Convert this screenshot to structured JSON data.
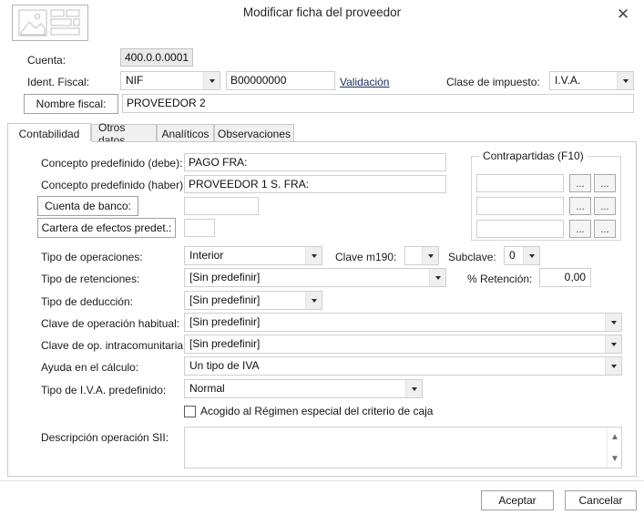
{
  "window": {
    "title": "Modificar ficha del proveedor",
    "close_label": "✕",
    "app_icon": "document-thumbnail-icon"
  },
  "header": {
    "cuenta_label": "Cuenta:",
    "cuenta_value": "400.0.0.0001",
    "ident_fiscal_label": "Ident. Fiscal:",
    "ident_fiscal_type": "NIF",
    "ident_fiscal_number": "B00000000",
    "validacion_link": "Validación",
    "clase_impuesto_label": "Clase de impuesto:",
    "clase_impuesto_value": "I.V.A.",
    "nombre_fiscal_button": "Nombre fiscal:",
    "nombre_fiscal_value": "PROVEEDOR 2"
  },
  "tabs": [
    {
      "label": "Contabilidad",
      "active": true
    },
    {
      "label": "Otros datos",
      "active": false
    },
    {
      "label": "Analíticos",
      "active": false
    },
    {
      "label": "Observaciones",
      "active": false
    }
  ],
  "contabilidad": {
    "concepto_debe_label": "Concepto predefinido (debe):",
    "concepto_debe_value": "PAGO FRA:",
    "concepto_haber_label": "Concepto predefinido (haber):",
    "concepto_haber_value": "PROVEEDOR 1 S. FRA:",
    "cuenta_banco_button": "Cuenta de banco:",
    "cuenta_banco_value": "",
    "cartera_efectos_button": "Cartera de efectos predet.:",
    "cartera_efectos_value": "",
    "tipo_operaciones_label": "Tipo de operaciones:",
    "tipo_operaciones_value": "Interior",
    "clave_m190_label": "Clave m190:",
    "clave_m190_value": "",
    "subclave_label": "Subclave:",
    "subclave_value": "0",
    "tipo_retenciones_label": "Tipo de retenciones:",
    "tipo_retenciones_value": "[Sin predefinir]",
    "pct_retencion_label": "% Retención:",
    "pct_retencion_value": "0,00",
    "tipo_deduccion_label": "Tipo de deducción:",
    "tipo_deduccion_value": "[Sin predefinir]",
    "clave_op_habitual_label": "Clave de operación habitual:",
    "clave_op_habitual_value": "[Sin predefinir]",
    "clave_op_intra_label": "Clave de op. intracomunitaria:",
    "clave_op_intra_value": "[Sin predefinir]",
    "ayuda_calculo_label": "Ayuda en el cálculo:",
    "ayuda_calculo_value": "Un tipo de IVA",
    "tipo_iva_label": "Tipo de I.V.A. predefinido:",
    "tipo_iva_value": "Normal",
    "regimen_caja_label": "Acogido al Régimen especial del criterio de caja",
    "regimen_caja_checked": false,
    "descripcion_sii_label": "Descripción operación SII:",
    "descripcion_sii_value": ""
  },
  "contrapartidas": {
    "title": "Contrapartidas (F10)",
    "rows": [
      {
        "value": "",
        "btn1": "...",
        "btn2": "..."
      },
      {
        "value": "",
        "btn1": "...",
        "btn2": "..."
      },
      {
        "value": "",
        "btn1": "...",
        "btn2": "..."
      }
    ]
  },
  "footer": {
    "accept_label": "Aceptar",
    "cancel_label": "Cancelar"
  },
  "colors": {
    "dialog_bg": "#ffffff",
    "field_border": "#cfcfcf",
    "readonly_bg": "#e9e9e9",
    "link": "#1a2d5a",
    "tab_inactive_bg": "#f0f0f0"
  }
}
